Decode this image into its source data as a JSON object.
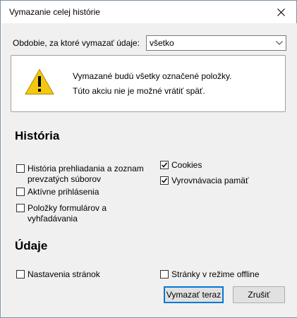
{
  "window": {
    "title": "Vymazanie celej histórie"
  },
  "period": {
    "label": "Obdobie, za ktoré vymazať údaje:",
    "selected": "všetko"
  },
  "warning": {
    "line1": "Vymazané budú všetky označené položky.",
    "line2": "Túto akciu nie je možné vrátiť späť."
  },
  "history": {
    "heading": "História",
    "items": [
      {
        "label_line1": "História prehliadania a zoznam",
        "label_line2": "prevzatých súborov",
        "checked": false
      },
      {
        "label_line1": "Aktívne prihlásenia",
        "checked": false
      },
      {
        "label_line1": "Položky formulárov a",
        "label_line2": "vyhľadávania",
        "checked": false
      },
      {
        "label_line1": "Cookies",
        "checked": true
      },
      {
        "label_line1": "Vyrovnávacia pamäť",
        "checked": true
      }
    ]
  },
  "data_section": {
    "heading": "Údaje",
    "items": [
      {
        "label_line1": "Nastavenia stránok",
        "checked": false
      },
      {
        "label_line1": "Stránky v režime offline",
        "checked": false
      }
    ]
  },
  "buttons": {
    "clear": "Vymazať teraz",
    "cancel": "Zrušiť"
  },
  "colors": {
    "accent": "#0078d7",
    "warning_yellow": "#f2c811"
  }
}
